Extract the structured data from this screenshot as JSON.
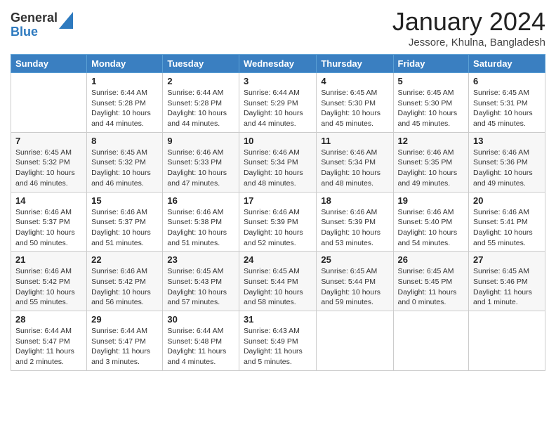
{
  "header": {
    "logo_general": "General",
    "logo_blue": "Blue",
    "month_title": "January 2024",
    "location": "Jessore, Khulna, Bangladesh"
  },
  "days_of_week": [
    "Sunday",
    "Monday",
    "Tuesday",
    "Wednesday",
    "Thursday",
    "Friday",
    "Saturday"
  ],
  "weeks": [
    [
      {
        "day": "",
        "info": ""
      },
      {
        "day": "1",
        "info": "Sunrise: 6:44 AM\nSunset: 5:28 PM\nDaylight: 10 hours\nand 44 minutes."
      },
      {
        "day": "2",
        "info": "Sunrise: 6:44 AM\nSunset: 5:28 PM\nDaylight: 10 hours\nand 44 minutes."
      },
      {
        "day": "3",
        "info": "Sunrise: 6:44 AM\nSunset: 5:29 PM\nDaylight: 10 hours\nand 44 minutes."
      },
      {
        "day": "4",
        "info": "Sunrise: 6:45 AM\nSunset: 5:30 PM\nDaylight: 10 hours\nand 45 minutes."
      },
      {
        "day": "5",
        "info": "Sunrise: 6:45 AM\nSunset: 5:30 PM\nDaylight: 10 hours\nand 45 minutes."
      },
      {
        "day": "6",
        "info": "Sunrise: 6:45 AM\nSunset: 5:31 PM\nDaylight: 10 hours\nand 45 minutes."
      }
    ],
    [
      {
        "day": "7",
        "info": "Sunrise: 6:45 AM\nSunset: 5:32 PM\nDaylight: 10 hours\nand 46 minutes."
      },
      {
        "day": "8",
        "info": "Sunrise: 6:45 AM\nSunset: 5:32 PM\nDaylight: 10 hours\nand 46 minutes."
      },
      {
        "day": "9",
        "info": "Sunrise: 6:46 AM\nSunset: 5:33 PM\nDaylight: 10 hours\nand 47 minutes."
      },
      {
        "day": "10",
        "info": "Sunrise: 6:46 AM\nSunset: 5:34 PM\nDaylight: 10 hours\nand 48 minutes."
      },
      {
        "day": "11",
        "info": "Sunrise: 6:46 AM\nSunset: 5:34 PM\nDaylight: 10 hours\nand 48 minutes."
      },
      {
        "day": "12",
        "info": "Sunrise: 6:46 AM\nSunset: 5:35 PM\nDaylight: 10 hours\nand 49 minutes."
      },
      {
        "day": "13",
        "info": "Sunrise: 6:46 AM\nSunset: 5:36 PM\nDaylight: 10 hours\nand 49 minutes."
      }
    ],
    [
      {
        "day": "14",
        "info": "Sunrise: 6:46 AM\nSunset: 5:37 PM\nDaylight: 10 hours\nand 50 minutes."
      },
      {
        "day": "15",
        "info": "Sunrise: 6:46 AM\nSunset: 5:37 PM\nDaylight: 10 hours\nand 51 minutes."
      },
      {
        "day": "16",
        "info": "Sunrise: 6:46 AM\nSunset: 5:38 PM\nDaylight: 10 hours\nand 51 minutes."
      },
      {
        "day": "17",
        "info": "Sunrise: 6:46 AM\nSunset: 5:39 PM\nDaylight: 10 hours\nand 52 minutes."
      },
      {
        "day": "18",
        "info": "Sunrise: 6:46 AM\nSunset: 5:39 PM\nDaylight: 10 hours\nand 53 minutes."
      },
      {
        "day": "19",
        "info": "Sunrise: 6:46 AM\nSunset: 5:40 PM\nDaylight: 10 hours\nand 54 minutes."
      },
      {
        "day": "20",
        "info": "Sunrise: 6:46 AM\nSunset: 5:41 PM\nDaylight: 10 hours\nand 55 minutes."
      }
    ],
    [
      {
        "day": "21",
        "info": "Sunrise: 6:46 AM\nSunset: 5:42 PM\nDaylight: 10 hours\nand 55 minutes."
      },
      {
        "day": "22",
        "info": "Sunrise: 6:46 AM\nSunset: 5:42 PM\nDaylight: 10 hours\nand 56 minutes."
      },
      {
        "day": "23",
        "info": "Sunrise: 6:45 AM\nSunset: 5:43 PM\nDaylight: 10 hours\nand 57 minutes."
      },
      {
        "day": "24",
        "info": "Sunrise: 6:45 AM\nSunset: 5:44 PM\nDaylight: 10 hours\nand 58 minutes."
      },
      {
        "day": "25",
        "info": "Sunrise: 6:45 AM\nSunset: 5:44 PM\nDaylight: 10 hours\nand 59 minutes."
      },
      {
        "day": "26",
        "info": "Sunrise: 6:45 AM\nSunset: 5:45 PM\nDaylight: 11 hours\nand 0 minutes."
      },
      {
        "day": "27",
        "info": "Sunrise: 6:45 AM\nSunset: 5:46 PM\nDaylight: 11 hours\nand 1 minute."
      }
    ],
    [
      {
        "day": "28",
        "info": "Sunrise: 6:44 AM\nSunset: 5:47 PM\nDaylight: 11 hours\nand 2 minutes."
      },
      {
        "day": "29",
        "info": "Sunrise: 6:44 AM\nSunset: 5:47 PM\nDaylight: 11 hours\nand 3 minutes."
      },
      {
        "day": "30",
        "info": "Sunrise: 6:44 AM\nSunset: 5:48 PM\nDaylight: 11 hours\nand 4 minutes."
      },
      {
        "day": "31",
        "info": "Sunrise: 6:43 AM\nSunset: 5:49 PM\nDaylight: 11 hours\nand 5 minutes."
      },
      {
        "day": "",
        "info": ""
      },
      {
        "day": "",
        "info": ""
      },
      {
        "day": "",
        "info": ""
      }
    ]
  ]
}
